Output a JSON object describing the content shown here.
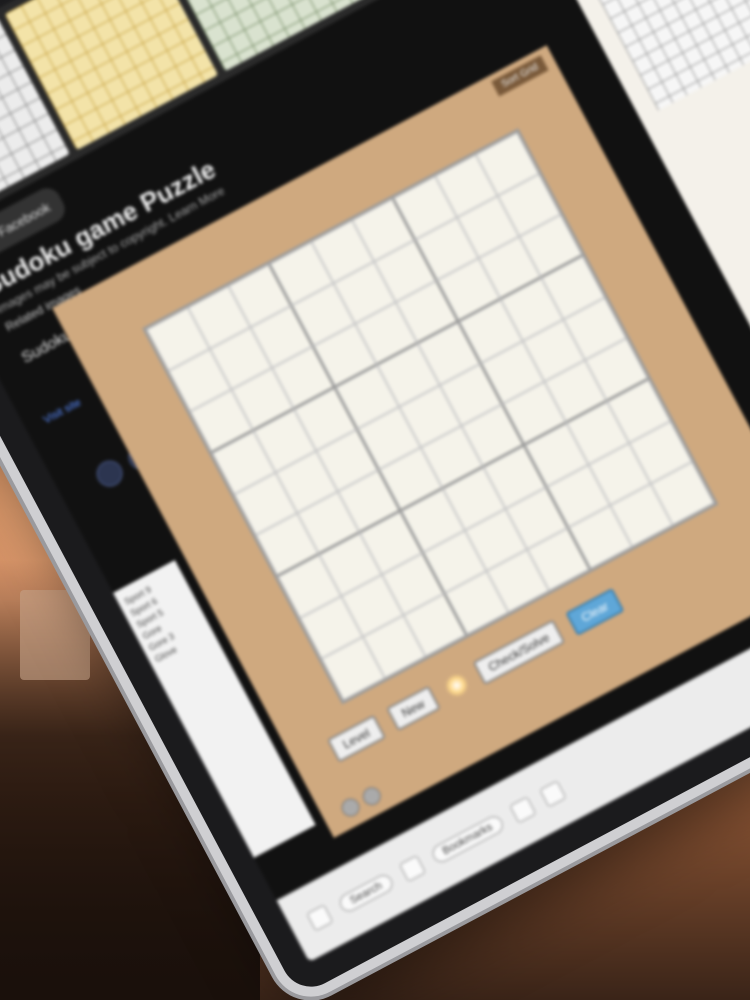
{
  "header": {
    "facebook_label": "Facebook",
    "title": "Sudoku game Puzzle",
    "subtitle": "Images may be subject to copyright. Learn More",
    "related": "Related images",
    "source": "Sudoku game Puzzle • Pinta | Facebook",
    "visit": "Visit site"
  },
  "game": {
    "top_label": "Sort Grid",
    "grid": [
      [
        "",
        "",
        "",
        "",
        "",
        "",
        "",
        "",
        ""
      ],
      [
        "",
        "",
        "",
        "",
        "",
        "",
        "",
        "",
        ""
      ],
      [
        "",
        "",
        "",
        "",
        "",
        "",
        "",
        "",
        ""
      ],
      [
        "",
        "",
        "",
        "",
        "",
        "",
        "",
        "",
        ""
      ],
      [
        "",
        "",
        "",
        "",
        "",
        "",
        "",
        "",
        ""
      ],
      [
        "",
        "",
        "",
        "",
        "",
        "",
        "",
        "",
        ""
      ],
      [
        "",
        "",
        "",
        "",
        "",
        "",
        "",
        "",
        ""
      ],
      [
        "",
        "",
        "",
        "",
        "",
        "",
        "",
        "",
        ""
      ],
      [
        "",
        "",
        "",
        "",
        "",
        "",
        "",
        "",
        ""
      ]
    ],
    "controls": {
      "level_select": "Level",
      "new_game": "New",
      "solve": "Check/Solve",
      "clear": "Clear"
    }
  },
  "left_list": [
    "Sport 9",
    "Sport 6",
    "Sport 5",
    "Gore",
    "Gore 3",
    "Glove"
  ],
  "footer": {
    "search_label": "Search",
    "tab_label": "Bookmarks"
  }
}
